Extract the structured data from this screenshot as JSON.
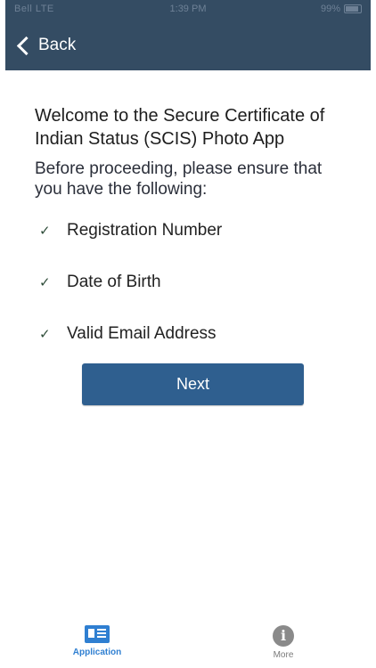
{
  "status_bar": {
    "carrier": "Bell LTE",
    "time": "1:39 PM",
    "battery": "99%"
  },
  "nav": {
    "back_label": "Back"
  },
  "main": {
    "welcome_text": "Welcome to the Secure Certificate of Indian Status (SCIS) Photo App",
    "instructions_text": "Before proceeding, please ensure that you have the following:",
    "checklist": [
      {
        "label": "Registration Number",
        "icon": "checkmark-icon"
      },
      {
        "label": "Date of Birth",
        "icon": "checkmark-icon"
      },
      {
        "label": "Valid Email Address",
        "icon": "checkmark-icon"
      }
    ],
    "next_label": "Next"
  },
  "tabbar": {
    "tabs": [
      {
        "label": "Application",
        "icon": "id-card-icon",
        "active": true
      },
      {
        "label": "More",
        "icon": "info-icon",
        "active": false
      }
    ]
  },
  "colors": {
    "header": "#344c63",
    "button": "#2f5f8f",
    "active_tab": "#2f7fd1",
    "inactive_tab": "#7a7a7a"
  }
}
